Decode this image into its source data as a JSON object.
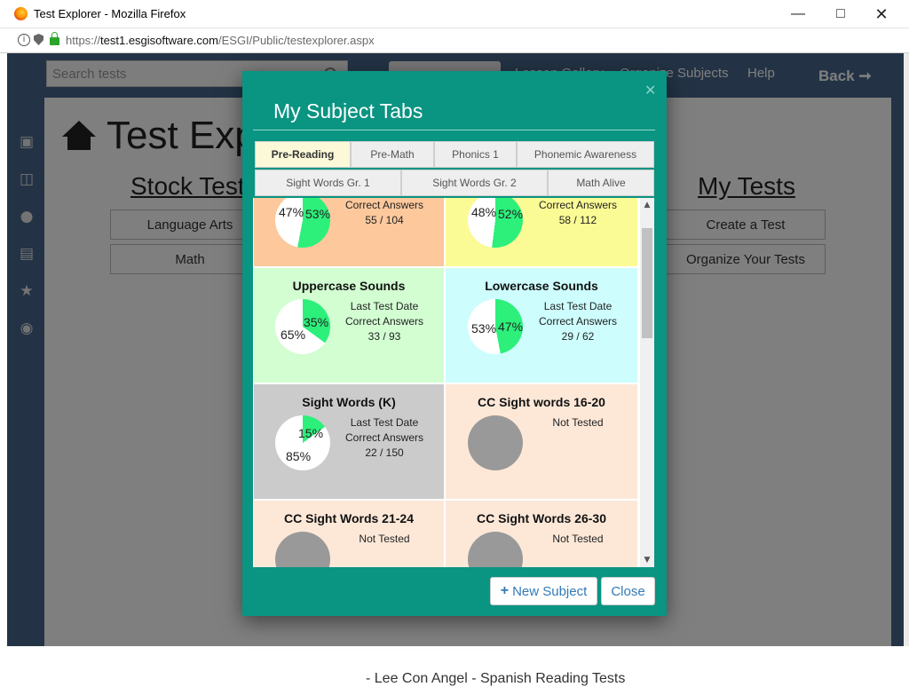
{
  "browser": {
    "window_title": "Test Explorer - Mozilla Firefox",
    "url_scheme": "https://",
    "url_host": "test1.esgisoftware.com",
    "url_path": "/ESGI/Public/testexplorer.aspx",
    "icons": [
      "firefox-logo-icon",
      "info-icon",
      "shield-icon",
      "lock-icon",
      "minimize-icon",
      "maximize-icon",
      "close-icon"
    ]
  },
  "background": {
    "search_placeholder": "Search tests",
    "nav_items": [
      "Lesson Gallery",
      "Organize Subjects",
      "Help"
    ],
    "back_label": "Back ➞",
    "page_title": "Test Explorer",
    "stock_tests_heading": "Stock Tests",
    "my_tests_heading": "My Tests",
    "stock_buttons": [
      "Language Arts",
      "Math"
    ],
    "my_buttons": [
      "Create a Test",
      "Organize Your Tests"
    ],
    "footer_text": "- Lee Con Angel - Spanish Reading Tests"
  },
  "modal": {
    "title": "My Subject Tabs",
    "tabs_row1": [
      "Pre-Reading",
      "Pre-Math",
      "Phonics 1",
      "Phonemic Awareness"
    ],
    "tabs_row2": [
      "Sight Words Gr. 1",
      "Sight Words Gr. 2",
      "Math Alive"
    ],
    "active_tab": "Pre-Reading",
    "cards": [
      {
        "title": "",
        "correct_pct": 53,
        "incorrect_pct": 47,
        "last_test_date_label": "",
        "correct_answers_label": "Correct Answers",
        "score": "55 / 104",
        "bg": "#fcc89c"
      },
      {
        "title": "",
        "correct_pct": 52,
        "incorrect_pct": 48,
        "last_test_date_label": "",
        "correct_answers_label": "Correct Answers",
        "score": "58 / 112",
        "bg": "#fbfb96"
      },
      {
        "title": "Uppercase Sounds",
        "correct_pct": 35,
        "incorrect_pct": 65,
        "last_test_date_label": "Last Test Date",
        "correct_answers_label": "Correct Answers",
        "score": "33 / 93",
        "bg": "#d2fed2"
      },
      {
        "title": "Lowercase Sounds",
        "correct_pct": 47,
        "incorrect_pct": 53,
        "last_test_date_label": "Last Test Date",
        "correct_answers_label": "Correct Answers",
        "score": "29 / 62",
        "bg": "#cdfdfd"
      },
      {
        "title": "Sight Words (K)",
        "correct_pct": 15,
        "incorrect_pct": 85,
        "last_test_date_label": "Last Test Date",
        "correct_answers_label": "Correct Answers",
        "score": "22 / 150",
        "bg": "#cbcbcb"
      },
      {
        "title": "CC Sight words 16-20",
        "status": "Not Tested",
        "bg": "#fde8d8"
      },
      {
        "title": "CC Sight Words 21-24",
        "status": "Not Tested",
        "bg": "#fde8d8"
      },
      {
        "title": "CC Sight Words 26-30",
        "status": "Not Tested",
        "bg": "#fde8d8"
      }
    ],
    "new_subject_label": "New Subject",
    "close_label": "Close"
  },
  "colors": {
    "modal_teal": "#0a9482",
    "pie_correct": "#2cf07a",
    "pie_incorrect": "#ffffff",
    "pie_untested": "#999999",
    "active_tab_bg": "#fbf9d8",
    "link_blue": "#337ab7"
  }
}
